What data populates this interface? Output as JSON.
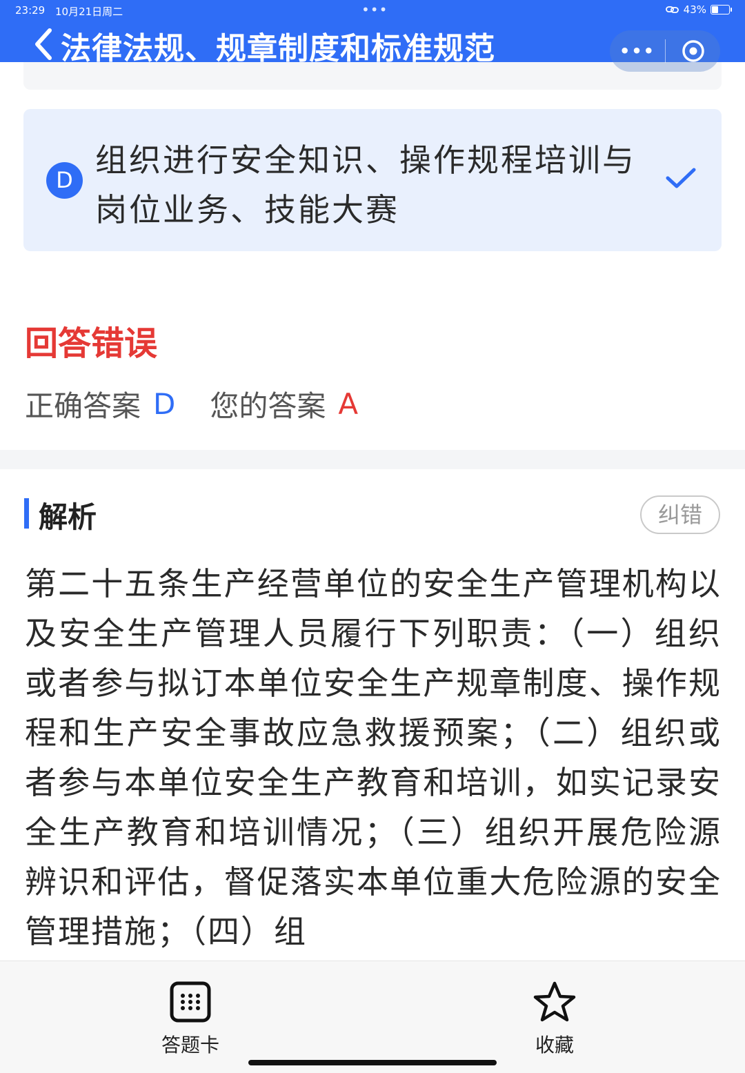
{
  "status_bar": {
    "time": "23:29",
    "date": "10月21日周二",
    "dots": "•••",
    "battery": "43%",
    "battery_level": 0.43
  },
  "nav": {
    "title": "法律法规、规章制度和标准规范",
    "more_label": "•••"
  },
  "option_d": {
    "letter": "D",
    "text": "组织进行安全知识、操作规程培训与岗位业务、技能大赛"
  },
  "result": {
    "title": "回答错误",
    "correct_label": "正确答案",
    "correct_letter": "D",
    "yours_label": "您的答案",
    "yours_letter": "A"
  },
  "analysis": {
    "title": "解析",
    "report_label": "纠错",
    "body": "第二十五条生产经营单位的安全生产管理机构以及安全生产管理人员履行下列职责：（一）组织或者参与拟订本单位安全生产规章制度、操作规程和生产安全事故应急救援预案；（二）组织或者参与本单位安全生产教育和培训，如实记录安全生产教育和培训情况；（三）组织开展危险源辨识和评估，督促落实本单位重大危险源的安全管理措施；（四）组"
  },
  "bottom_nav": {
    "card_label": "答题卡",
    "fav_label": "收藏"
  },
  "colors": {
    "accent": "#2f6df6",
    "error": "#e53935",
    "option_selected_bg": "#e9f0fd"
  }
}
